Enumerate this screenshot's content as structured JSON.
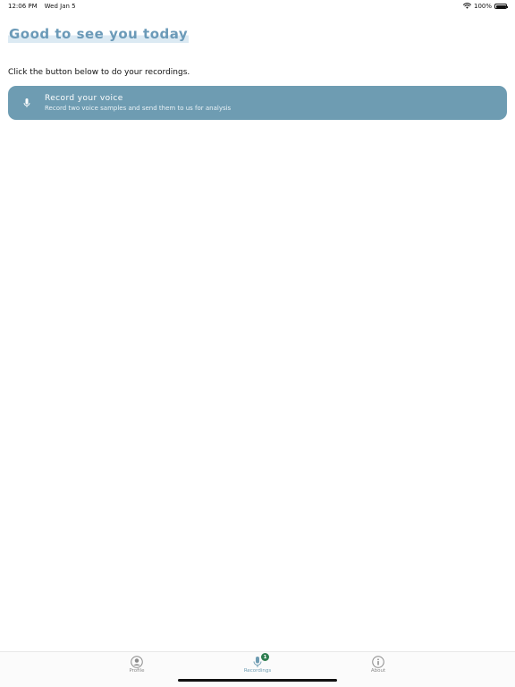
{
  "status_bar": {
    "time": "12:06 PM",
    "date": "Wed Jan 5",
    "battery": "100%"
  },
  "page": {
    "title": "Good to see you today",
    "instruction": "Click the button below to do your recordings."
  },
  "record_card": {
    "title": "Record your voice",
    "subtitle": "Record two voice samples and send them to us for analysis",
    "icon": "microphone-icon"
  },
  "tabs": [
    {
      "label": "Profile",
      "icon": "person-circle-icon",
      "active": false
    },
    {
      "label": "Recordings",
      "icon": "microphone-icon",
      "active": true,
      "badge": "1"
    },
    {
      "label": "About",
      "icon": "info-circle-icon",
      "active": false
    }
  ],
  "colors": {
    "accent": "#6e9cb2",
    "title": "#6b9ab8",
    "badge": "#2e7d4f"
  }
}
